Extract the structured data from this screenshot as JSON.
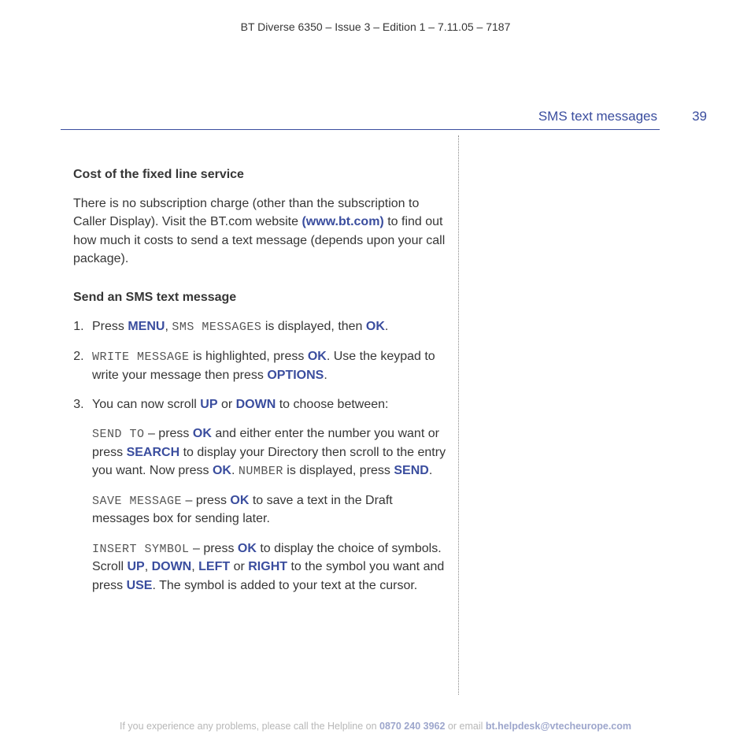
{
  "header": {
    "doc_id": "BT Diverse 6350 – Issue 3 – Edition 1 – 7.11.05 – 7187"
  },
  "page": {
    "section": "SMS text messages",
    "number": "39"
  },
  "body": {
    "h1": "Cost of the fixed line service",
    "p1_a": "There is no subscription charge (other than the subscription to Caller Display). Visit the BT.com website ",
    "p1_link": "(www.bt.com)",
    "p1_b": " to find out how much it costs to send a text message (depends upon your call package).",
    "h2": "Send an SMS text message",
    "s1_a": "Press ",
    "s1_menu": "MENU",
    "s1_b": ", ",
    "s1_lcd": "SMS MESSAGES",
    "s1_c": " is displayed, then ",
    "s1_ok": "OK",
    "s1_d": ".",
    "s2_lcd": "WRITE MESSAGE",
    "s2_a": " is highlighted, press ",
    "s2_ok": "OK",
    "s2_b": ". Use the keypad to write your message then press ",
    "s2_opt": "OPTIONS",
    "s2_c": ".",
    "s3_a": "You can now scroll ",
    "s3_up": "UP",
    "s3_b": " or ",
    "s3_down": "DOWN",
    "s3_c": " to choose between:",
    "sub1_lcd": "SEND TO",
    "sub1_a": " – press ",
    "sub1_ok1": "OK",
    "sub1_b": " and either enter the number you want or press ",
    "sub1_search": "SEARCH",
    "sub1_c": " to display your Directory then scroll to the entry you want. Now press ",
    "sub1_ok2": "OK",
    "sub1_d": ". ",
    "sub1_lcd2": "NUMBER",
    "sub1_e": " is displayed, press ",
    "sub1_send": "SEND",
    "sub1_f": ".",
    "sub2_lcd": "SAVE MESSAGE",
    "sub2_a": " – press ",
    "sub2_ok": "OK",
    "sub2_b": " to save a text in the Draft messages box for sending later.",
    "sub3_lcd": "INSERT SYMBOL",
    "sub3_a": " – press ",
    "sub3_ok": "OK",
    "sub3_b": " to display the choice of symbols. Scroll ",
    "sub3_up": "UP",
    "sub3_c": ", ",
    "sub3_down": "DOWN",
    "sub3_d": ", ",
    "sub3_left": "LEFT",
    "sub3_e": " or ",
    "sub3_right": "RIGHT",
    "sub3_f": " to the symbol you want and press ",
    "sub3_use": "USE",
    "sub3_g": ". The symbol is added to your text at the cursor."
  },
  "footer": {
    "a": "If you experience any problems, please call the Helpline on ",
    "phone": "0870 240 3962",
    "b": " or email ",
    "email": "bt.helpdesk@vtecheurope.com"
  }
}
